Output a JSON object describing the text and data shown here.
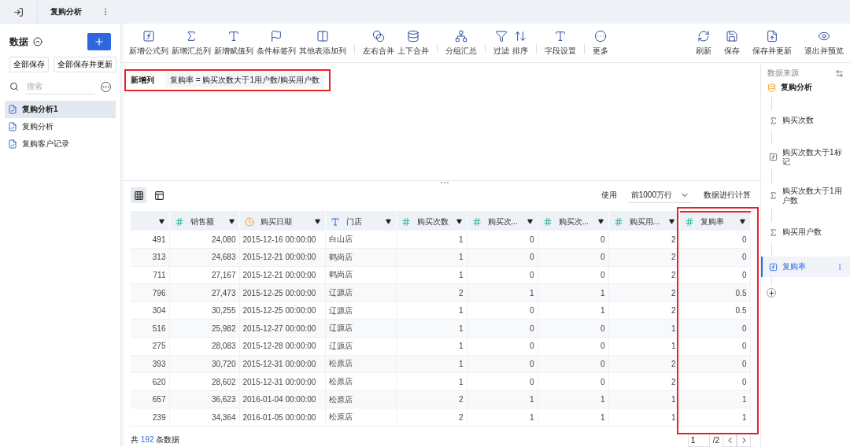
{
  "top_bar": {
    "tab_title": "复购分析"
  },
  "sidebar": {
    "title": "数据",
    "buttons": [
      "全部保存",
      "全部保存并更新"
    ],
    "search": {
      "placeholder": "搜索"
    },
    "items": [
      {
        "label": "复购分析1",
        "selected": true
      },
      {
        "label": "复购分析",
        "selected": false
      },
      {
        "label": "复购客户记录",
        "selected": false
      }
    ]
  },
  "toolbar": {
    "groups": [
      [
        "新增公式列",
        "新增汇总列",
        "新增赋值列",
        "条件标签列",
        "其他表添加列"
      ],
      [
        "左右合并",
        "上下合并"
      ],
      [
        "分组汇总"
      ],
      [
        "过滤",
        "排序"
      ],
      [
        "字段设置"
      ],
      [
        "更多"
      ]
    ],
    "right_actions": [
      "刷新",
      "保存",
      "保存并更新",
      "退出并预览"
    ]
  },
  "formula_bar": {
    "label": "新增列",
    "formula": "复购率 = 购买次数大于1用户数/购买用户数",
    "highlighted": true
  },
  "table_toolbar": {
    "views": [
      {
        "selected": true
      },
      {
        "selected": false
      }
    ],
    "use_label": "使用",
    "row_limit": "前1000万行",
    "suffix": "数据进行计算"
  },
  "table": {
    "columns": [
      {
        "kind": "cut",
        "highlighted": false
      },
      {
        "label": "销售额",
        "kind": "number",
        "highlighted": false
      },
      {
        "label": "购买日期",
        "kind": "date",
        "highlighted": false
      },
      {
        "label": "门店",
        "kind": "text",
        "highlighted": false
      },
      {
        "label": "购买次数",
        "kind": "number",
        "highlighted": false
      },
      {
        "label": "购买次...",
        "kind": "number",
        "highlighted": false
      },
      {
        "label": "购买次...",
        "kind": "number",
        "highlighted": false
      },
      {
        "label": "购买用...",
        "kind": "number",
        "highlighted": false
      },
      {
        "label": "复购率",
        "kind": "number",
        "highlighted": true
      }
    ],
    "rows": [
      [
        "491",
        "24,080",
        "2015-12-16 00:00:00",
        "白山店",
        "1",
        "0",
        "0",
        "2",
        "0"
      ],
      [
        "313",
        "24,683",
        "2015-12-21 00:00:00",
        "鹤岗店",
        "1",
        "0",
        "0",
        "2",
        "0"
      ],
      [
        "711",
        "27,167",
        "2015-12-21 00:00:00",
        "鹤岗店",
        "1",
        "0",
        "0",
        "2",
        "0"
      ],
      [
        "796",
        "27,473",
        "2015-12-25 00:00:00",
        "辽源店",
        "2",
        "1",
        "1",
        "2",
        "0.5"
      ],
      [
        "304",
        "30,255",
        "2015-12-25 00:00:00",
        "辽源店",
        "1",
        "0",
        "1",
        "2",
        "0.5"
      ],
      [
        "516",
        "25,982",
        "2015-12-27 00:00:00",
        "辽源店",
        "1",
        "0",
        "0",
        "1",
        "0"
      ],
      [
        "275",
        "28,083",
        "2015-12-28 00:00:00",
        "辽源店",
        "1",
        "0",
        "0",
        "1",
        "0"
      ],
      [
        "393",
        "30,720",
        "2015-12-31 00:00:00",
        "松原店",
        "1",
        "0",
        "0",
        "2",
        "0"
      ],
      [
        "620",
        "28,602",
        "2015-12-31 00:00:00",
        "松原店",
        "1",
        "0",
        "0",
        "2",
        "0"
      ],
      [
        "657",
        "36,623",
        "2016-01-04 00:00:00",
        "松原店",
        "2",
        "1",
        "1",
        "1",
        "1"
      ],
      [
        "239",
        "34,364",
        "2016-01-05 00:00:00",
        "松原店",
        "2",
        "1",
        "1",
        "1",
        "1"
      ]
    ]
  },
  "footer": {
    "prefix": "共",
    "count": "192",
    "suffix": "条数据",
    "page": "1",
    "page_total": "/2"
  },
  "right_panel": {
    "title": "数据来源",
    "source": "复购分析",
    "steps": [
      {
        "label": "购买次数",
        "kind": "sum",
        "selected": false
      },
      {
        "label": "购买次数大于1标记",
        "kind": "formula",
        "selected": false
      },
      {
        "label": "购买次数大于1用户数",
        "kind": "sum",
        "selected": false
      },
      {
        "label": "购买用户数",
        "kind": "sum",
        "selected": false
      },
      {
        "label": "复购率",
        "kind": "formula",
        "selected": true
      }
    ]
  }
}
